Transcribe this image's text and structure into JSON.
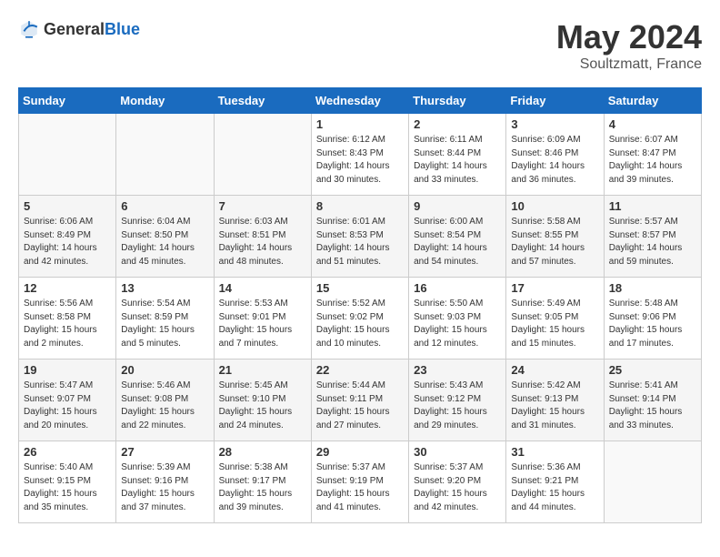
{
  "header": {
    "logo_general": "General",
    "logo_blue": "Blue",
    "month": "May 2024",
    "location": "Soultzmatt, France"
  },
  "weekdays": [
    "Sunday",
    "Monday",
    "Tuesday",
    "Wednesday",
    "Thursday",
    "Friday",
    "Saturday"
  ],
  "weeks": [
    [
      {
        "day": "",
        "info": ""
      },
      {
        "day": "",
        "info": ""
      },
      {
        "day": "",
        "info": ""
      },
      {
        "day": "1",
        "info": "Sunrise: 6:12 AM\nSunset: 8:43 PM\nDaylight: 14 hours\nand 30 minutes."
      },
      {
        "day": "2",
        "info": "Sunrise: 6:11 AM\nSunset: 8:44 PM\nDaylight: 14 hours\nand 33 minutes."
      },
      {
        "day": "3",
        "info": "Sunrise: 6:09 AM\nSunset: 8:46 PM\nDaylight: 14 hours\nand 36 minutes."
      },
      {
        "day": "4",
        "info": "Sunrise: 6:07 AM\nSunset: 8:47 PM\nDaylight: 14 hours\nand 39 minutes."
      }
    ],
    [
      {
        "day": "5",
        "info": "Sunrise: 6:06 AM\nSunset: 8:49 PM\nDaylight: 14 hours\nand 42 minutes."
      },
      {
        "day": "6",
        "info": "Sunrise: 6:04 AM\nSunset: 8:50 PM\nDaylight: 14 hours\nand 45 minutes."
      },
      {
        "day": "7",
        "info": "Sunrise: 6:03 AM\nSunset: 8:51 PM\nDaylight: 14 hours\nand 48 minutes."
      },
      {
        "day": "8",
        "info": "Sunrise: 6:01 AM\nSunset: 8:53 PM\nDaylight: 14 hours\nand 51 minutes."
      },
      {
        "day": "9",
        "info": "Sunrise: 6:00 AM\nSunset: 8:54 PM\nDaylight: 14 hours\nand 54 minutes."
      },
      {
        "day": "10",
        "info": "Sunrise: 5:58 AM\nSunset: 8:55 PM\nDaylight: 14 hours\nand 57 minutes."
      },
      {
        "day": "11",
        "info": "Sunrise: 5:57 AM\nSunset: 8:57 PM\nDaylight: 14 hours\nand 59 minutes."
      }
    ],
    [
      {
        "day": "12",
        "info": "Sunrise: 5:56 AM\nSunset: 8:58 PM\nDaylight: 15 hours\nand 2 minutes."
      },
      {
        "day": "13",
        "info": "Sunrise: 5:54 AM\nSunset: 8:59 PM\nDaylight: 15 hours\nand 5 minutes."
      },
      {
        "day": "14",
        "info": "Sunrise: 5:53 AM\nSunset: 9:01 PM\nDaylight: 15 hours\nand 7 minutes."
      },
      {
        "day": "15",
        "info": "Sunrise: 5:52 AM\nSunset: 9:02 PM\nDaylight: 15 hours\nand 10 minutes."
      },
      {
        "day": "16",
        "info": "Sunrise: 5:50 AM\nSunset: 9:03 PM\nDaylight: 15 hours\nand 12 minutes."
      },
      {
        "day": "17",
        "info": "Sunrise: 5:49 AM\nSunset: 9:05 PM\nDaylight: 15 hours\nand 15 minutes."
      },
      {
        "day": "18",
        "info": "Sunrise: 5:48 AM\nSunset: 9:06 PM\nDaylight: 15 hours\nand 17 minutes."
      }
    ],
    [
      {
        "day": "19",
        "info": "Sunrise: 5:47 AM\nSunset: 9:07 PM\nDaylight: 15 hours\nand 20 minutes."
      },
      {
        "day": "20",
        "info": "Sunrise: 5:46 AM\nSunset: 9:08 PM\nDaylight: 15 hours\nand 22 minutes."
      },
      {
        "day": "21",
        "info": "Sunrise: 5:45 AM\nSunset: 9:10 PM\nDaylight: 15 hours\nand 24 minutes."
      },
      {
        "day": "22",
        "info": "Sunrise: 5:44 AM\nSunset: 9:11 PM\nDaylight: 15 hours\nand 27 minutes."
      },
      {
        "day": "23",
        "info": "Sunrise: 5:43 AM\nSunset: 9:12 PM\nDaylight: 15 hours\nand 29 minutes."
      },
      {
        "day": "24",
        "info": "Sunrise: 5:42 AM\nSunset: 9:13 PM\nDaylight: 15 hours\nand 31 minutes."
      },
      {
        "day": "25",
        "info": "Sunrise: 5:41 AM\nSunset: 9:14 PM\nDaylight: 15 hours\nand 33 minutes."
      }
    ],
    [
      {
        "day": "26",
        "info": "Sunrise: 5:40 AM\nSunset: 9:15 PM\nDaylight: 15 hours\nand 35 minutes."
      },
      {
        "day": "27",
        "info": "Sunrise: 5:39 AM\nSunset: 9:16 PM\nDaylight: 15 hours\nand 37 minutes."
      },
      {
        "day": "28",
        "info": "Sunrise: 5:38 AM\nSunset: 9:17 PM\nDaylight: 15 hours\nand 39 minutes."
      },
      {
        "day": "29",
        "info": "Sunrise: 5:37 AM\nSunset: 9:19 PM\nDaylight: 15 hours\nand 41 minutes."
      },
      {
        "day": "30",
        "info": "Sunrise: 5:37 AM\nSunset: 9:20 PM\nDaylight: 15 hours\nand 42 minutes."
      },
      {
        "day": "31",
        "info": "Sunrise: 5:36 AM\nSunset: 9:21 PM\nDaylight: 15 hours\nand 44 minutes."
      },
      {
        "day": "",
        "info": ""
      }
    ]
  ]
}
